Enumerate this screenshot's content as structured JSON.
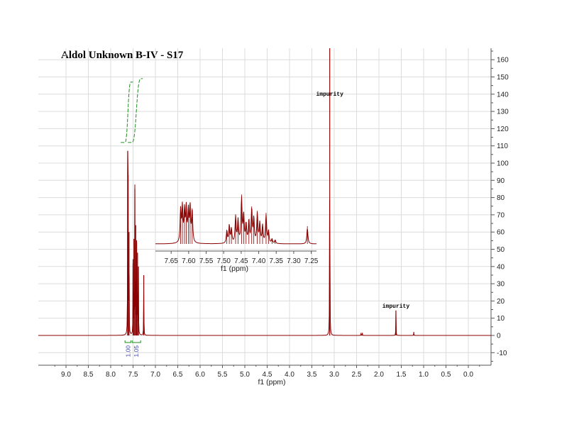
{
  "chart_data": {
    "type": "line",
    "title": "Aldol Unknown B-IV - S17",
    "xlabel": "f1 (ppm)",
    "ylabel": "",
    "xlim": [
      9.5,
      -0.5
    ],
    "ylim": [
      -15,
      167
    ],
    "x_ticks": [
      "9.0",
      "8.5",
      "8.0",
      "7.5",
      "7.0",
      "6.5",
      "6.0",
      "5.5",
      "5.0",
      "4.5",
      "4.0",
      "3.5",
      "3.0",
      "2.5",
      "2.0",
      "1.5",
      "1.0",
      "0.5",
      "0.0"
    ],
    "y_ticks": [
      "-10",
      "0",
      "10",
      "20",
      "30",
      "40",
      "50",
      "60",
      "70",
      "80",
      "90",
      "100",
      "110",
      "120",
      "130",
      "140",
      "150",
      "160"
    ],
    "grid": true,
    "series": [
      {
        "color": "#8b0000",
        "peaks": [
          {
            "x": 7.62,
            "y": 107
          },
          {
            "x": 7.61,
            "y": 93
          },
          {
            "x": 7.59,
            "y": 60
          },
          {
            "x": 7.5,
            "y": 42
          },
          {
            "x": 7.48,
            "y": 56
          },
          {
            "x": 7.46,
            "y": 85
          },
          {
            "x": 7.44,
            "y": 64
          },
          {
            "x": 7.42,
            "y": 54
          },
          {
            "x": 7.4,
            "y": 48
          },
          {
            "x": 7.38,
            "y": 40
          },
          {
            "x": 7.26,
            "y": 35
          },
          {
            "x": 3.1,
            "y": 167
          },
          {
            "x": 2.4,
            "y": 1.5
          },
          {
            "x": 2.37,
            "y": 1.5
          },
          {
            "x": 1.62,
            "y": 14.5
          },
          {
            "x": 1.22,
            "y": 2
          }
        ]
      }
    ],
    "integrals": [
      {
        "from": 7.68,
        "to": 7.55,
        "value": "1.00",
        "curve_y": [
          112,
          147
        ]
      },
      {
        "from": 7.52,
        "to": 7.33,
        "value": "1.05",
        "curve_y": [
          112,
          149
        ]
      }
    ],
    "annotations": [
      {
        "text": "impurity",
        "x": 3.1,
        "y": 139
      },
      {
        "text": "impurity",
        "x": 1.62,
        "y": 16
      }
    ],
    "inset": {
      "xlabel": "f1 (ppm)",
      "xlim": [
        7.695,
        7.235
      ],
      "x_ticks": [
        "7.65",
        "7.60",
        "7.55",
        "7.50",
        "7.45",
        "7.40",
        "7.35",
        "7.30",
        "7.25"
      ],
      "peaks": [
        {
          "x": 7.623,
          "y": 0.74
        },
        {
          "x": 7.618,
          "y": 0.79
        },
        {
          "x": 7.612,
          "y": 0.7
        },
        {
          "x": 7.607,
          "y": 0.77
        },
        {
          "x": 7.601,
          "y": 0.7
        },
        {
          "x": 7.596,
          "y": 0.8
        },
        {
          "x": 7.59,
          "y": 0.72
        },
        {
          "x": 7.491,
          "y": 0.28
        },
        {
          "x": 7.484,
          "y": 0.4
        },
        {
          "x": 7.478,
          "y": 0.32
        },
        {
          "x": 7.466,
          "y": 0.6
        },
        {
          "x": 7.459,
          "y": 0.52
        },
        {
          "x": 7.449,
          "y": 1.0
        },
        {
          "x": 7.443,
          "y": 0.62
        },
        {
          "x": 7.436,
          "y": 0.42
        },
        {
          "x": 7.428,
          "y": 0.5
        },
        {
          "x": 7.42,
          "y": 0.76
        },
        {
          "x": 7.414,
          "y": 0.55
        },
        {
          "x": 7.404,
          "y": 0.67
        },
        {
          "x": 7.397,
          "y": 0.45
        },
        {
          "x": 7.389,
          "y": 0.4
        },
        {
          "x": 7.379,
          "y": 0.63
        },
        {
          "x": 7.372,
          "y": 0.28
        },
        {
          "x": 7.362,
          "y": 0.1
        },
        {
          "x": 7.353,
          "y": 0.08
        },
        {
          "x": 7.261,
          "y": 0.36
        }
      ]
    }
  }
}
